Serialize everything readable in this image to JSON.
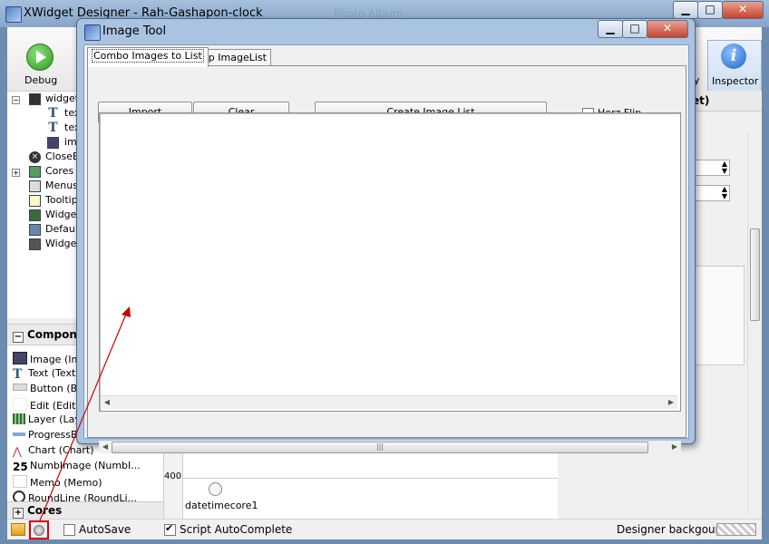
{
  "main_window": {
    "title": "XWidget Designer - Rah-Gashapon-clock",
    "behind_title": "Photo Album",
    "minimize": "▁",
    "maximize": "□",
    "close": "✕"
  },
  "toolbar": {
    "debug_label": "Debug",
    "partial_label": "y",
    "inspector_label": "Inspector",
    "inspector_glyph": "i"
  },
  "tree": {
    "items": [
      {
        "label": "widget",
        "icon": "widget-grid-icon"
      },
      {
        "label": "tex",
        "icon": "text-icon"
      },
      {
        "label": "tex",
        "icon": "text-icon"
      },
      {
        "label": "ima",
        "icon": "image-icon"
      },
      {
        "label": "CloseBu",
        "icon": "close-circle-icon"
      },
      {
        "label": "Cores",
        "icon": "cores-icon"
      },
      {
        "label": "Menus",
        "icon": "menu-icon"
      },
      {
        "label": "Tooltip",
        "icon": "tooltip-icon"
      },
      {
        "label": "Widget",
        "icon": "widget-icon"
      },
      {
        "label": "Defaul",
        "icon": "default-icon"
      },
      {
        "label": "Widget",
        "icon": "widget-icon"
      }
    ]
  },
  "palette": {
    "header": "Compone",
    "items": [
      {
        "label": "Image (Ima"
      },
      {
        "label": "Text (Text"
      },
      {
        "label": "Button (Bu"
      },
      {
        "label": "Edit (Edit)"
      },
      {
        "label": "Layer (Lay"
      },
      {
        "label": "ProgressBa"
      },
      {
        "label": "Chart (Chart)"
      },
      {
        "label": "NumbImage (NumbI..."
      },
      {
        "label": "Memo (Memo)"
      },
      {
        "label": "RoundLine (RoundLi..."
      }
    ],
    "numb_glyph": "25",
    "cores_header": "Cores",
    "expand_sign": "+",
    "collapse_sign": "−"
  },
  "design": {
    "ruler_label": "400",
    "core_label": "datetimecore1"
  },
  "right_panel": {
    "header_partial": "et)"
  },
  "status": {
    "autosave_label": "AutoSave",
    "autosave_checked": false,
    "script_autocomplete_label": "Script AutoComplete",
    "script_autocomplete_checked": true,
    "designer_background_label": "Designer backgound"
  },
  "dialog": {
    "title": "Image Tool",
    "tabs": [
      {
        "label": "Combo Images to List",
        "active": true
      },
      {
        "label": "Clip ImageList",
        "active": false
      }
    ],
    "buttons": {
      "import": "Import",
      "clear": "Clear",
      "create_image_list": "Create Image List"
    },
    "horz_flip_label": "Horz Flip",
    "horz_flip_checked": false,
    "scroll_left": "◀",
    "scroll_right": "▶",
    "scroll_grip": "|||"
  },
  "colors": {
    "annotation_red": "#cc0000"
  }
}
